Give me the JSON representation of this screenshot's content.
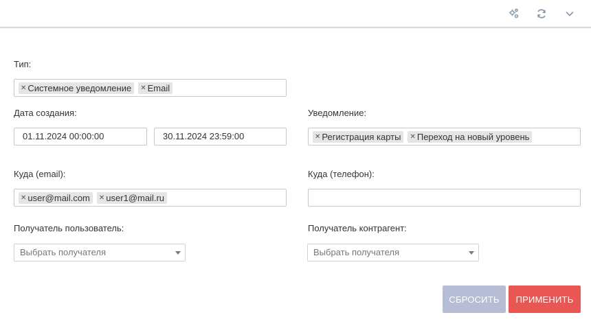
{
  "filters": {
    "type": {
      "label": "Тип:",
      "tags": [
        "Системное уведомление",
        "Email"
      ]
    },
    "created": {
      "label": "Дата создания:",
      "from": "01.11.2024 00:00:00",
      "to": "30.11.2024 23:59:00"
    },
    "notification": {
      "label": "Уведомление:",
      "tags": [
        "Регистрация карты",
        "Переход на новый уровень"
      ]
    },
    "to_email": {
      "label": "Куда (email):",
      "tags": [
        "user@mail.com",
        "user1@mail.ru"
      ]
    },
    "to_phone": {
      "label": "Куда (телефон):",
      "value": ""
    },
    "recipient_user": {
      "label": "Получатель пользователь:",
      "placeholder": "Выбрать получателя"
    },
    "recipient_contractor": {
      "label": "Получатель контрагент:",
      "placeholder": "Выбрать получателя"
    }
  },
  "actions": {
    "reset_label": "СБРОСИТЬ",
    "apply_label": "ПРИМЕНИТЬ"
  },
  "icons": {
    "settings": "cogs-icon",
    "refresh": "refresh-icon",
    "collapse": "chevron-down-icon",
    "tag_remove": "close-icon"
  },
  "colors": {
    "reset_button": "#b7bdd4",
    "apply_button": "#e85753"
  }
}
